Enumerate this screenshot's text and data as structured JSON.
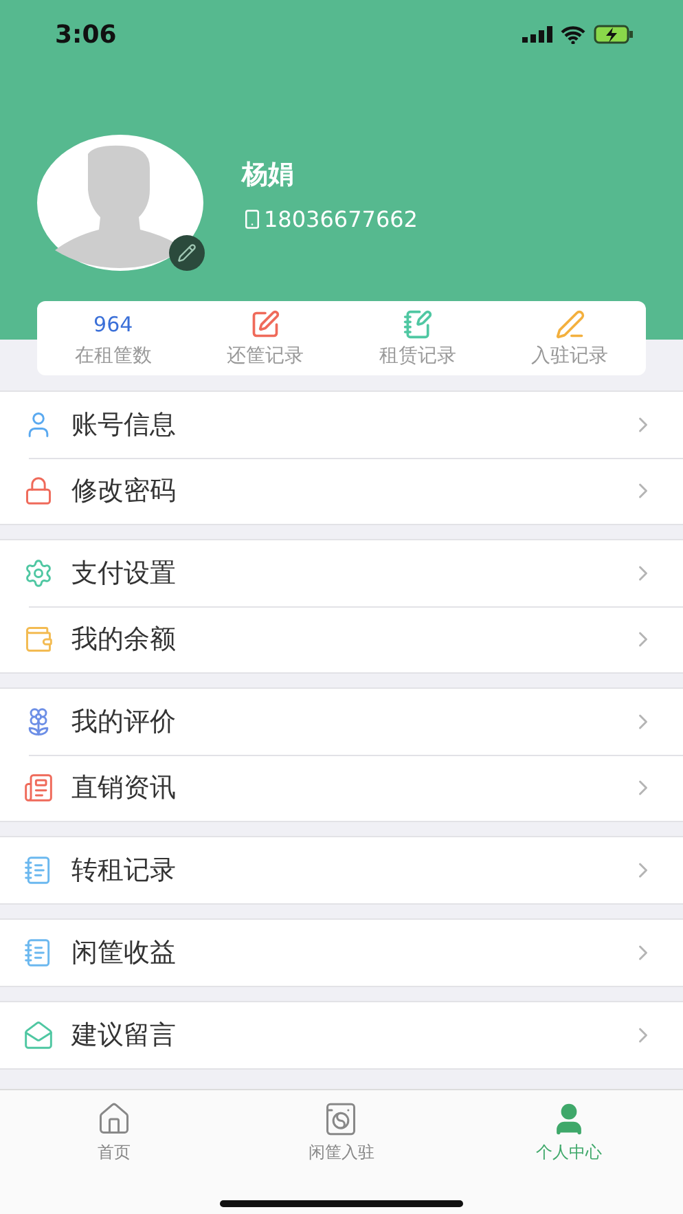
{
  "status_bar": {
    "time": "3:06"
  },
  "profile": {
    "name": "杨娟",
    "phone": "18036677662"
  },
  "stats": [
    {
      "kind": "count",
      "value": "964",
      "label": "在租筐数"
    },
    {
      "kind": "return",
      "label": "还筐记录"
    },
    {
      "kind": "lease",
      "label": "租赁记录"
    },
    {
      "kind": "join",
      "label": "入驻记录"
    }
  ],
  "menu_groups": [
    {
      "items": [
        {
          "kind": "user",
          "label": "账号信息"
        },
        {
          "kind": "lock",
          "label": "修改密码"
        }
      ]
    },
    {
      "items": [
        {
          "kind": "gear",
          "label": "支付设置"
        },
        {
          "kind": "wallet",
          "label": "我的余额"
        }
      ]
    },
    {
      "items": [
        {
          "kind": "flower",
          "label": "我的评价"
        },
        {
          "kind": "news",
          "label": "直销资讯"
        }
      ]
    },
    {
      "items": [
        {
          "kind": "notepad",
          "label": "转租记录"
        }
      ]
    },
    {
      "items": [
        {
          "kind": "notepad",
          "label": "闲筐收益"
        }
      ]
    },
    {
      "items": [
        {
          "kind": "mail",
          "label": "建议留言"
        }
      ]
    }
  ],
  "tab_bar": [
    {
      "kind": "home",
      "label": "首页",
      "selected": false
    },
    {
      "kind": "machine",
      "label": "闲筐入驻",
      "selected": false
    },
    {
      "kind": "person",
      "label": "个人中心",
      "selected": true
    }
  ]
}
